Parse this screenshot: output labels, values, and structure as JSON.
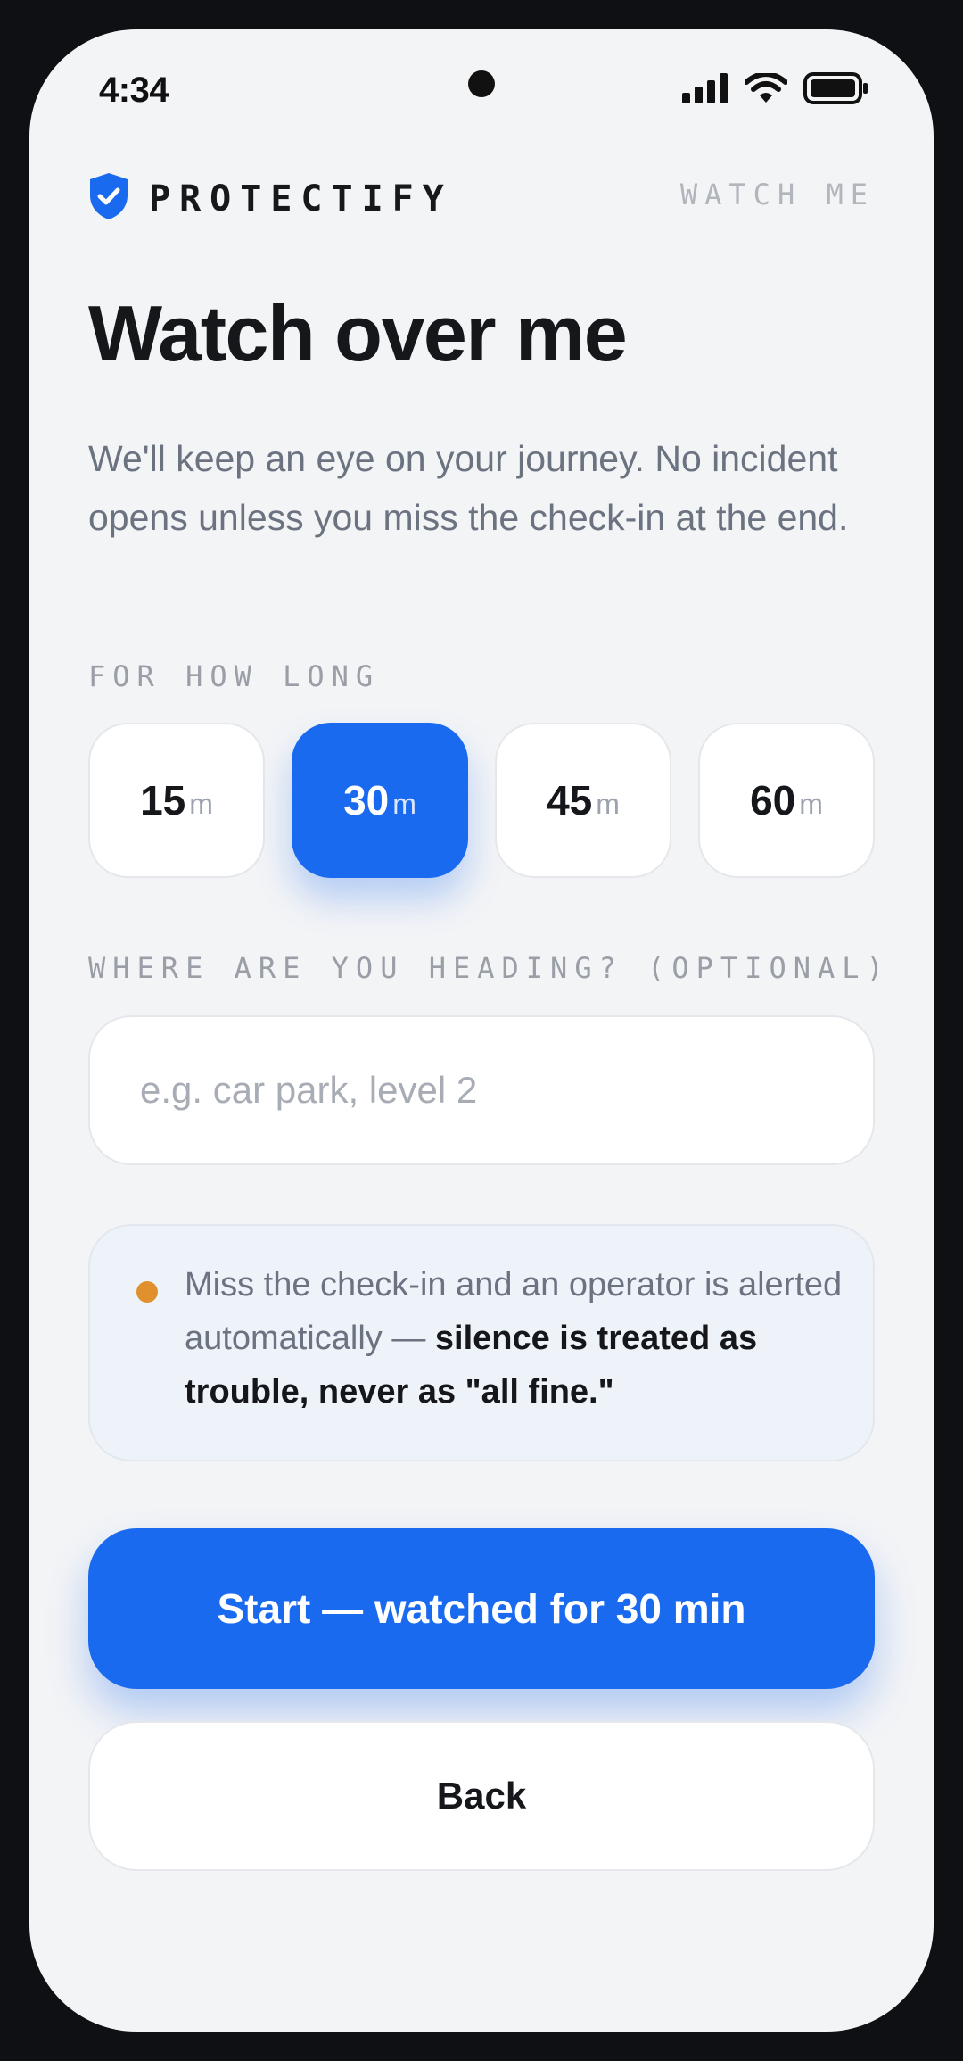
{
  "status_bar": {
    "time": "4:34",
    "icons": [
      "signal-icon",
      "wifi-icon",
      "battery-icon"
    ]
  },
  "header": {
    "brand_name": "PROTECTIFY",
    "brand_icon": "shield-check-icon",
    "tag": "WATCH ME"
  },
  "main": {
    "title": "Watch over me",
    "subtitle": "We'll keep an eye on your journey. No incident opens unless you miss the check-in at the end.",
    "duration_label": "FOR HOW LONG",
    "durations": [
      {
        "value": "15",
        "unit": "m",
        "selected": false
      },
      {
        "value": "30",
        "unit": "m",
        "selected": true
      },
      {
        "value": "45",
        "unit": "m",
        "selected": false
      },
      {
        "value": "60",
        "unit": "m",
        "selected": false
      }
    ],
    "destination_label": "WHERE ARE YOU HEADING? (OPTIONAL)",
    "destination_value": "",
    "destination_placeholder": "e.g. car park, level 2",
    "notice": {
      "text_plain": "Miss the check-in and an operator is alerted automatically —",
      "text_bold": "silence is treated as trouble, never as \"all fine.\""
    }
  },
  "actions": {
    "start_label": "Start — watched for 30 min",
    "back_label": "Back"
  },
  "colors": {
    "accent": "#1a6af0",
    "notice_dot": "#e0912e",
    "background": "#f3f4f6"
  }
}
